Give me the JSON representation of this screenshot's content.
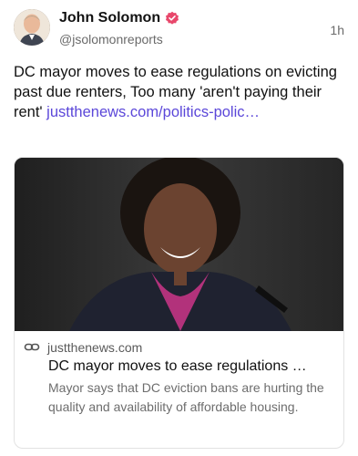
{
  "post": {
    "author_name": "John Solomon",
    "author_handle": "@jsolomonreports",
    "timestamp": "1h",
    "text": "DC mayor moves to ease regulations on evicting past due renters, Too many 'aren't paying their rent' ",
    "link_text": "justthenews.com/politics-polic…"
  },
  "link_card": {
    "domain": "justthenews.com",
    "title": "DC mayor moves to ease regulations …",
    "description": "Mayor says that DC eviction bans are hurting the quality and availability of affordable housing."
  },
  "icons": {
    "verified": "verified-badge-icon",
    "link": "link-icon"
  },
  "colors": {
    "link": "#5b47d9",
    "verified_badge": "#e8476b",
    "secondary_text": "#6a6a6a"
  }
}
